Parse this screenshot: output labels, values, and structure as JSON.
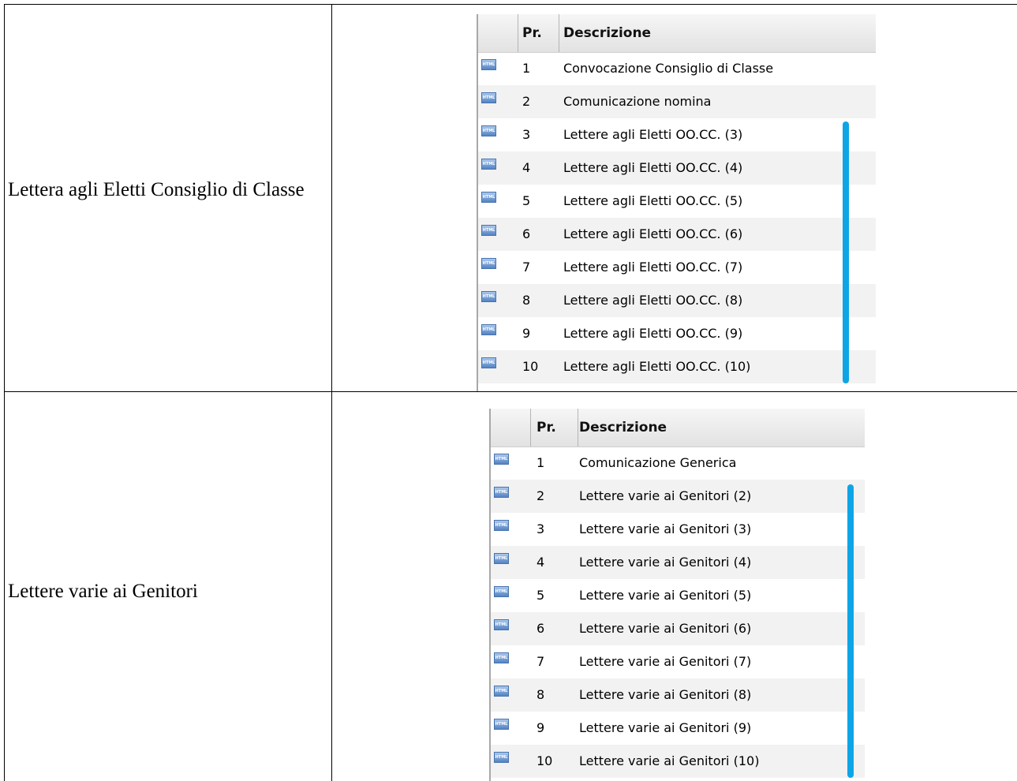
{
  "row1": {
    "label": "Lettera agli Eletti Consiglio di Classe",
    "grid": {
      "header": {
        "number": "Pr.",
        "description": "Descrizione"
      },
      "icon": "html-file-icon",
      "icon_text": "HTML",
      "rows": [
        {
          "number": "1",
          "description": "Convocazione Consiglio di Classe"
        },
        {
          "number": "2",
          "description": "Comunicazione nomina"
        },
        {
          "number": "3",
          "description": "Lettere agli Eletti OO.CC. (3)"
        },
        {
          "number": "4",
          "description": "Lettere agli Eletti OO.CC. (4)"
        },
        {
          "number": "5",
          "description": "Lettere agli Eletti OO.CC. (5)"
        },
        {
          "number": "6",
          "description": "Lettere agli Eletti OO.CC. (6)"
        },
        {
          "number": "7",
          "description": "Lettere agli Eletti OO.CC. (7)"
        },
        {
          "number": "8",
          "description": "Lettere agli Eletti OO.CC. (8)"
        },
        {
          "number": "9",
          "description": "Lettere agli Eletti OO.CC. (9)"
        },
        {
          "number": "10",
          "description": "Lettere agli Eletti OO.CC. (10)"
        }
      ]
    }
  },
  "row2": {
    "label": "Lettere varie ai Genitori",
    "grid": {
      "header": {
        "number": "Pr.",
        "description": "Descrizione"
      },
      "icon": "html-file-icon",
      "icon_text": "HTML",
      "rows": [
        {
          "number": "1",
          "description": "Comunicazione Generica"
        },
        {
          "number": "2",
          "description": "Lettere varie ai Genitori (2)"
        },
        {
          "number": "3",
          "description": "Lettere varie ai Genitori (3)"
        },
        {
          "number": "4",
          "description": "Lettere varie ai Genitori (4)"
        },
        {
          "number": "5",
          "description": "Lettere varie ai Genitori (5)"
        },
        {
          "number": "6",
          "description": "Lettere varie ai Genitori (6)"
        },
        {
          "number": "7",
          "description": "Lettere varie ai Genitori (7)"
        },
        {
          "number": "8",
          "description": "Lettere varie ai Genitori (8)"
        },
        {
          "number": "9",
          "description": "Lettere varie ai Genitori (9)"
        },
        {
          "number": "10",
          "description": "Lettere varie ai Genitori (10)"
        }
      ]
    }
  },
  "colors": {
    "highlight_bar": "#0ea5e6",
    "alt_row": "#f2f2f2",
    "icon_blue": "#5484c4"
  }
}
